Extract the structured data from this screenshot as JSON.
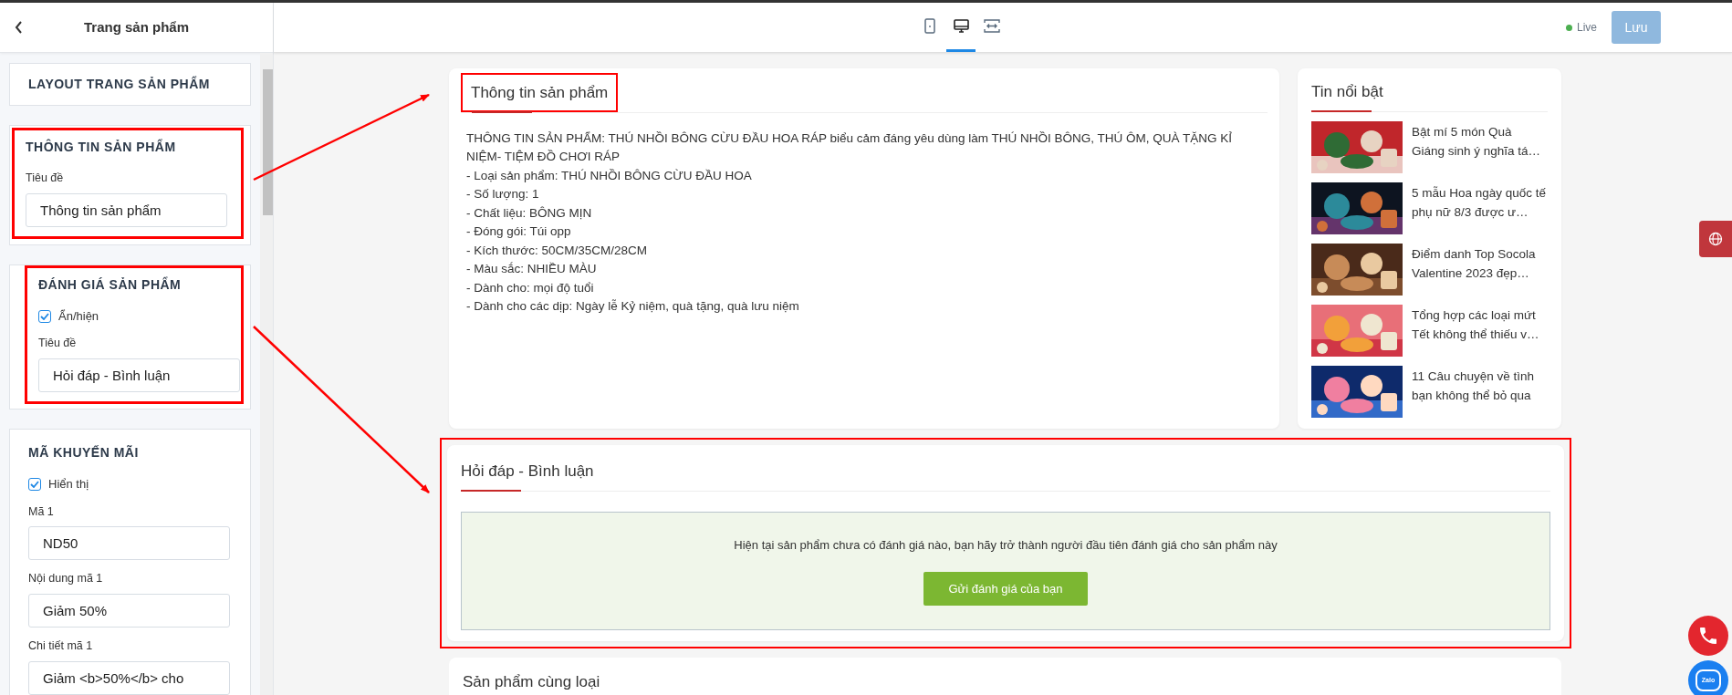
{
  "panel": {
    "title": "Trang sản phẩm"
  },
  "toolbar": {
    "devices": [
      {
        "kind": "tablet",
        "selected": false
      },
      {
        "kind": "desktop",
        "selected": true
      },
      {
        "kind": "fullwidth",
        "selected": false
      }
    ],
    "status": "Live",
    "save_button": {
      "label": "Lưu",
      "disabled": true
    }
  },
  "settings_sections": [
    {
      "title": "LAYOUT TRANG SẢN PHẨM",
      "highlighted": false
    },
    {
      "title": "THÔNG TIN SẢN PHẨM",
      "highlighted": true,
      "fields": [
        {
          "kind": "text",
          "label": "Tiêu đề",
          "value": "Thông tin sản phẩm"
        }
      ]
    },
    {
      "title": "ĐÁNH GIÁ SẢN PHẨM",
      "highlighted": true,
      "fields": [
        {
          "kind": "checkbox",
          "label": "Ẩn/hiện",
          "checked": true
        },
        {
          "kind": "text",
          "label": "Tiêu đề",
          "value": "Hỏi đáp - Bình luận"
        }
      ]
    },
    {
      "title": "MÃ KHUYẾN MÃI",
      "highlighted": false,
      "fields": [
        {
          "kind": "checkbox",
          "label": "Hiển thị",
          "checked": true
        },
        {
          "kind": "text",
          "label": "Mã 1",
          "value": "ND50"
        },
        {
          "kind": "text",
          "label": "Nội dung mã 1",
          "value": "Giảm 50%"
        },
        {
          "kind": "text",
          "label": "Chi tiết mã 1",
          "value": "Giảm <b>50%</b> cho"
        }
      ]
    }
  ],
  "product_info": {
    "title": "Thông tin sản phẩm",
    "highlighted": true,
    "lines": [
      "THÔNG TIN SẢN PHẨM: THÚ NHỒI BÔNG CỪU ĐẦU HOA RÁP biểu cảm đáng yêu dùng làm THÚ NHỒI BÔNG, THÚ ÔM, QUÀ TẶNG KỈ NIỆM- TIỆM ĐỒ CHƠI RÁP",
      "- Loại sản phẩm: THÚ NHỒI BÔNG CỪU ĐẦU HOA",
      "- Số lượng: 1",
      "- Chất liệu: BÔNG MỊN",
      "- Đóng gói: Túi opp",
      "- Kích thước:  50CM/35CM/28CM",
      "- Màu sắc: NHIỀU MÀU",
      "- Dành cho: mọi độ tuổi",
      "- Dành cho các dịp: Ngày lễ Kỷ niệm, quà tặng, quà lưu niệm"
    ]
  },
  "featured_news": {
    "title": "Tin nổi bật",
    "items": [
      {
        "title": "Bật mí 5 món Quà Giáng sinh ý nghĩa tá…"
      },
      {
        "title": "5 mẫu Hoa ngày quốc tế phụ nữ 8/3 được ư…"
      },
      {
        "title": "Điểm danh Top Socola Valentine 2023 đẹp…"
      },
      {
        "title": "Tổng hợp các loại mứt Tết không thể thiếu v…"
      },
      {
        "title": "11 Câu chuyện về tình bạn không thể bỏ qua"
      }
    ]
  },
  "reviews": {
    "title": "Hỏi đáp - Bình luận",
    "highlighted": true,
    "message": "Hiện tại sản phẩm chưa có đánh giá nào, bạn hãy trở thành người đầu tiên đánh giá cho sản phẩm này",
    "button": "Gửi đánh giá của bạn"
  },
  "related": {
    "title": "Sản phẩm cùng loại"
  },
  "floating": {
    "zalo_label": "Zalo"
  }
}
